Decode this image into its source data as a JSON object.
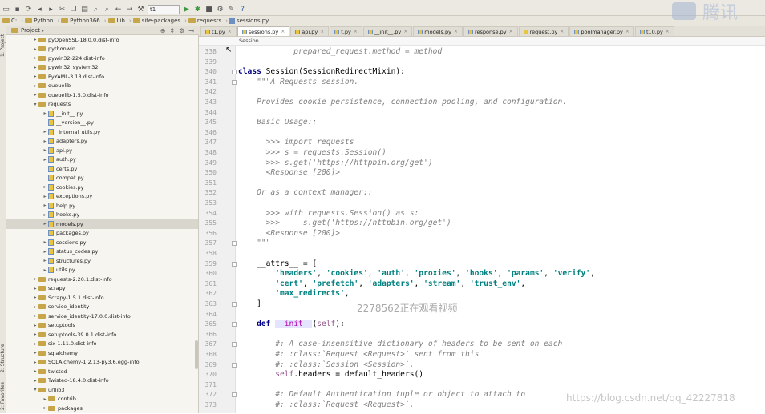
{
  "toolbar": {
    "run_config": "t1"
  },
  "navbar": {
    "crumbs": [
      "C:",
      "Python",
      "Python366",
      "Lib",
      "site-packages",
      "requests",
      "sessions.py"
    ]
  },
  "project_panel": {
    "title": "Project"
  },
  "side_tabs": {
    "project": "1: Project",
    "structure": "2: Structure",
    "favorites": "2: Favorites"
  },
  "tree": [
    {
      "indent": 2,
      "expanded": false,
      "type": "folder",
      "label": "pyOpenSSL-18.0.0.dist-info"
    },
    {
      "indent": 2,
      "expanded": false,
      "type": "folder",
      "label": "pythonwin"
    },
    {
      "indent": 2,
      "expanded": false,
      "type": "folder",
      "label": "pywin32-224.dist-info"
    },
    {
      "indent": 2,
      "expanded": false,
      "type": "folder",
      "label": "pywin32_system32"
    },
    {
      "indent": 2,
      "expanded": false,
      "type": "folder",
      "label": "PyYAML-3.13.dist-info"
    },
    {
      "indent": 2,
      "expanded": false,
      "type": "folder",
      "label": "queuelib"
    },
    {
      "indent": 2,
      "expanded": false,
      "type": "folder",
      "label": "queuelib-1.5.0.dist-info"
    },
    {
      "indent": 2,
      "expanded": true,
      "type": "folder",
      "label": "requests"
    },
    {
      "indent": 3,
      "expanded": false,
      "type": "py",
      "label": "__init__.py"
    },
    {
      "indent": 3,
      "expanded": null,
      "type": "py",
      "label": "__version__.py"
    },
    {
      "indent": 3,
      "expanded": false,
      "type": "py",
      "label": "_internal_utils.py"
    },
    {
      "indent": 3,
      "expanded": false,
      "type": "py",
      "label": "adapters.py"
    },
    {
      "indent": 3,
      "expanded": false,
      "type": "py",
      "label": "api.py"
    },
    {
      "indent": 3,
      "expanded": false,
      "type": "py",
      "label": "auth.py"
    },
    {
      "indent": 3,
      "expanded": null,
      "type": "py",
      "label": "certs.py"
    },
    {
      "indent": 3,
      "expanded": null,
      "type": "py",
      "label": "compat.py"
    },
    {
      "indent": 3,
      "expanded": false,
      "type": "py",
      "label": "cookies.py"
    },
    {
      "indent": 3,
      "expanded": false,
      "type": "py",
      "label": "exceptions.py"
    },
    {
      "indent": 3,
      "expanded": false,
      "type": "py",
      "label": "help.py"
    },
    {
      "indent": 3,
      "expanded": false,
      "type": "py",
      "label": "hooks.py"
    },
    {
      "indent": 3,
      "expanded": false,
      "type": "py",
      "label": "models.py",
      "selected": true
    },
    {
      "indent": 3,
      "expanded": null,
      "type": "py",
      "label": "packages.py"
    },
    {
      "indent": 3,
      "expanded": false,
      "type": "py",
      "label": "sessions.py"
    },
    {
      "indent": 3,
      "expanded": false,
      "type": "py",
      "label": "status_codes.py"
    },
    {
      "indent": 3,
      "expanded": false,
      "type": "py",
      "label": "structures.py"
    },
    {
      "indent": 3,
      "expanded": false,
      "type": "py",
      "label": "utils.py"
    },
    {
      "indent": 2,
      "expanded": false,
      "type": "folder",
      "label": "requests-2.20.1.dist-info"
    },
    {
      "indent": 2,
      "expanded": false,
      "type": "folder",
      "label": "scrapy"
    },
    {
      "indent": 2,
      "expanded": false,
      "type": "folder",
      "label": "Scrapy-1.5.1.dist-info"
    },
    {
      "indent": 2,
      "expanded": false,
      "type": "folder",
      "label": "service_identity"
    },
    {
      "indent": 2,
      "expanded": false,
      "type": "folder",
      "label": "service_identity-17.0.0.dist-info"
    },
    {
      "indent": 2,
      "expanded": false,
      "type": "folder",
      "label": "setuptools"
    },
    {
      "indent": 2,
      "expanded": false,
      "type": "folder",
      "label": "setuptools-39.0.1.dist-info"
    },
    {
      "indent": 2,
      "expanded": false,
      "type": "folder",
      "label": "six-1.11.0.dist-info"
    },
    {
      "indent": 2,
      "expanded": false,
      "type": "folder",
      "label": "sqlalchemy"
    },
    {
      "indent": 2,
      "expanded": false,
      "type": "folder",
      "label": "SQLAlchemy-1.2.13-py3.6.egg-info"
    },
    {
      "indent": 2,
      "expanded": false,
      "type": "folder",
      "label": "twisted"
    },
    {
      "indent": 2,
      "expanded": false,
      "type": "folder",
      "label": "Twisted-18.4.0.dist-info"
    },
    {
      "indent": 2,
      "expanded": true,
      "type": "folder",
      "label": "urllib3"
    },
    {
      "indent": 3,
      "expanded": false,
      "type": "folder",
      "label": "contrib"
    },
    {
      "indent": 3,
      "expanded": false,
      "type": "folder",
      "label": "packages"
    }
  ],
  "tabs": [
    {
      "label": "t1.py",
      "active": false
    },
    {
      "label": "sessions.py",
      "active": true
    },
    {
      "label": "api.py",
      "active": false
    },
    {
      "label": "t.py",
      "active": false
    },
    {
      "label": "__init__.py",
      "active": false
    },
    {
      "label": "models.py",
      "active": false
    },
    {
      "label": "response.py",
      "active": false
    },
    {
      "label": "request.py",
      "active": false
    },
    {
      "label": "poolmanager.py",
      "active": false
    },
    {
      "label": "t10.py",
      "active": false
    }
  ],
  "editor_breadcrumb": "Session",
  "line_numbers": [
    "338",
    "339",
    "340",
    "341",
    "342",
    "343",
    "344",
    "345",
    "346",
    "347",
    "348",
    "349",
    "350",
    "351",
    "352",
    "353",
    "354",
    "355",
    "356",
    "357",
    "358",
    "359",
    "360",
    "361",
    "362",
    "363",
    "364",
    "365",
    "366",
    "367",
    "368",
    "369",
    "370",
    "371",
    "372",
    "373"
  ],
  "code": [
    {
      "ln": "338",
      "segs": [
        [
          "doc",
          "            prepared_request.method = method"
        ]
      ]
    },
    {
      "ln": "339",
      "segs": []
    },
    {
      "ln": "340",
      "segs": [
        [
          "kw",
          "class "
        ],
        [
          "",
          "Session(SessionRedirectMixin):"
        ]
      ]
    },
    {
      "ln": "341",
      "segs": [
        [
          "doc",
          "    \"\"\"A Requests session."
        ]
      ]
    },
    {
      "ln": "342",
      "segs": []
    },
    {
      "ln": "343",
      "segs": [
        [
          "doc",
          "    Provides cookie persistence, connection pooling, and configuration."
        ]
      ]
    },
    {
      "ln": "344",
      "segs": []
    },
    {
      "ln": "345",
      "segs": [
        [
          "doc",
          "    Basic Usage::"
        ]
      ]
    },
    {
      "ln": "346",
      "segs": []
    },
    {
      "ln": "347",
      "segs": [
        [
          "doc",
          "      >>> import requests"
        ]
      ]
    },
    {
      "ln": "348",
      "segs": [
        [
          "doc",
          "      >>> s = requests.Session()"
        ]
      ]
    },
    {
      "ln": "349",
      "segs": [
        [
          "doc",
          "      >>> s.get('https://httpbin.org/get')"
        ]
      ]
    },
    {
      "ln": "350",
      "segs": [
        [
          "doc",
          "      <Response [200]>"
        ]
      ]
    },
    {
      "ln": "351",
      "segs": []
    },
    {
      "ln": "352",
      "segs": [
        [
          "doc",
          "    Or as a context manager::"
        ]
      ]
    },
    {
      "ln": "353",
      "segs": []
    },
    {
      "ln": "354",
      "segs": [
        [
          "doc",
          "      >>> with requests.Session() as s:"
        ]
      ]
    },
    {
      "ln": "355",
      "segs": [
        [
          "doc",
          "      >>>     s.get('https://httpbin.org/get')"
        ]
      ]
    },
    {
      "ln": "356",
      "segs": [
        [
          "doc",
          "      <Response [200]>"
        ]
      ]
    },
    {
      "ln": "357",
      "segs": [
        [
          "doc",
          "    \"\"\""
        ]
      ]
    },
    {
      "ln": "358",
      "segs": []
    },
    {
      "ln": "359",
      "segs": [
        [
          "",
          "    __attrs__ = ["
        ]
      ]
    },
    {
      "ln": "360",
      "segs": [
        [
          "",
          "        "
        ],
        [
          "str",
          "'headers'"
        ],
        [
          "",
          ", "
        ],
        [
          "str",
          "'cookies'"
        ],
        [
          "",
          ", "
        ],
        [
          "str",
          "'auth'"
        ],
        [
          "",
          ", "
        ],
        [
          "str",
          "'proxies'"
        ],
        [
          "",
          ", "
        ],
        [
          "str",
          "'hooks'"
        ],
        [
          "",
          ", "
        ],
        [
          "str",
          "'params'"
        ],
        [
          "",
          ", "
        ],
        [
          "str",
          "'verify'"
        ],
        [
          "",
          ","
        ]
      ]
    },
    {
      "ln": "361",
      "segs": [
        [
          "",
          "        "
        ],
        [
          "str",
          "'cert'"
        ],
        [
          "",
          ", "
        ],
        [
          "str",
          "'prefetch'"
        ],
        [
          "",
          ", "
        ],
        [
          "str",
          "'adapters'"
        ],
        [
          "",
          ", "
        ],
        [
          "str",
          "'stream'"
        ],
        [
          "",
          ", "
        ],
        [
          "str",
          "'trust_env'"
        ],
        [
          "",
          ","
        ]
      ]
    },
    {
      "ln": "362",
      "segs": [
        [
          "",
          "        "
        ],
        [
          "str",
          "'max_redirects'"
        ],
        [
          "",
          ","
        ]
      ]
    },
    {
      "ln": "363",
      "segs": [
        [
          "",
          "    ]"
        ]
      ]
    },
    {
      "ln": "364",
      "segs": []
    },
    {
      "ln": "365",
      "segs": [
        [
          "",
          "    "
        ],
        [
          "kw",
          "def "
        ],
        [
          "fn",
          "__init__"
        ],
        [
          "",
          "("
        ],
        [
          "slf",
          "self"
        ],
        [
          "",
          "):"
        ]
      ]
    },
    {
      "ln": "366",
      "segs": []
    },
    {
      "ln": "367",
      "segs": [
        [
          "cmt",
          "        #: A case-insensitive dictionary of headers to be sent on each"
        ]
      ]
    },
    {
      "ln": "368",
      "segs": [
        [
          "cmt",
          "        #: :class:`Request <Request>` sent from this"
        ]
      ]
    },
    {
      "ln": "369",
      "segs": [
        [
          "cmt",
          "        #: :class:`Session <Session>`."
        ]
      ]
    },
    {
      "ln": "370",
      "segs": [
        [
          "",
          "        "
        ],
        [
          "slf",
          "self"
        ],
        [
          "",
          ".headers = default_headers()"
        ]
      ]
    },
    {
      "ln": "371",
      "segs": []
    },
    {
      "ln": "372",
      "segs": [
        [
          "cmt",
          "        #: Default Authentication tuple or object to attach to"
        ]
      ]
    },
    {
      "ln": "373",
      "segs": [
        [
          "cmt",
          "        #: :class:`Request <Request>`."
        ]
      ]
    }
  ],
  "overlays": {
    "logo_text": "腾讯",
    "viewers": "2278562正在观看视频",
    "url": "https://blog.csdn.net/qq_42227818"
  }
}
